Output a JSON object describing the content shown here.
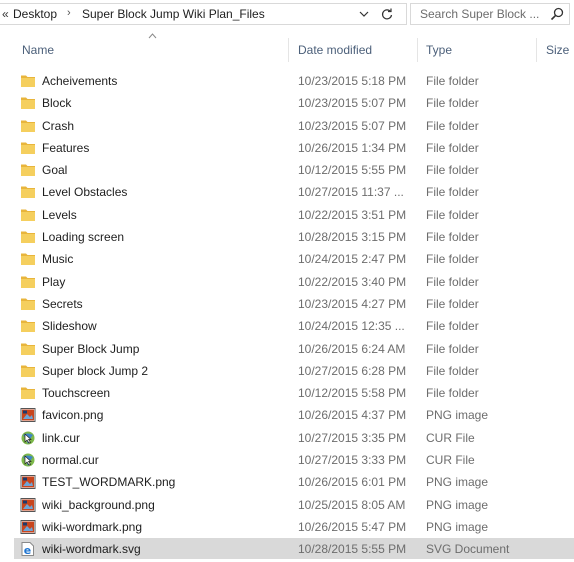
{
  "address_bar": {
    "overflow_glyph": "«",
    "crumbs": [
      "Desktop",
      "Super Block Jump Wiki Plan_Files"
    ],
    "separator": "›",
    "dropdown_icon": "chevron-down-icon",
    "refresh_icon": "refresh-icon"
  },
  "search": {
    "placeholder": "Search Super Block ...",
    "icon": "search-icon"
  },
  "columns": {
    "name": "Name",
    "date_modified": "Date modified",
    "type": "Type",
    "size": "Size",
    "sort_indicator": "sort-ascending-icon"
  },
  "colors": {
    "folder": "#f0c64a",
    "header_text": "#4c607a",
    "selected_row": "#d9d9d9"
  },
  "files": [
    {
      "name": "Acheivements",
      "date": "10/23/2015 5:18 PM",
      "type": "File folder",
      "icon": "folder-icon"
    },
    {
      "name": "Block",
      "date": "10/23/2015 5:07 PM",
      "type": "File folder",
      "icon": "folder-icon"
    },
    {
      "name": "Crash",
      "date": "10/23/2015 5:07 PM",
      "type": "File folder",
      "icon": "folder-icon"
    },
    {
      "name": "Features",
      "date": "10/26/2015 1:34 PM",
      "type": "File folder",
      "icon": "folder-icon"
    },
    {
      "name": "Goal",
      "date": "10/12/2015 5:55 PM",
      "type": "File folder",
      "icon": "folder-icon"
    },
    {
      "name": "Level Obstacles",
      "date": "10/27/2015 11:37 ...",
      "type": "File folder",
      "icon": "folder-icon"
    },
    {
      "name": "Levels",
      "date": "10/22/2015 3:51 PM",
      "type": "File folder",
      "icon": "folder-icon"
    },
    {
      "name": "Loading screen",
      "date": "10/28/2015 3:15 PM",
      "type": "File folder",
      "icon": "folder-icon"
    },
    {
      "name": "Music",
      "date": "10/24/2015 2:47 PM",
      "type": "File folder",
      "icon": "folder-icon"
    },
    {
      "name": "Play",
      "date": "10/22/2015 3:40 PM",
      "type": "File folder",
      "icon": "folder-icon"
    },
    {
      "name": "Secrets",
      "date": "10/23/2015 4:27 PM",
      "type": "File folder",
      "icon": "folder-icon"
    },
    {
      "name": "Slideshow",
      "date": "10/24/2015 12:35 ...",
      "type": "File folder",
      "icon": "folder-icon"
    },
    {
      "name": "Super Block Jump",
      "date": "10/26/2015 6:24 AM",
      "type": "File folder",
      "icon": "folder-icon"
    },
    {
      "name": "Super block Jump 2",
      "date": "10/27/2015 6:28 PM",
      "type": "File folder",
      "icon": "folder-icon"
    },
    {
      "name": "Touchscreen",
      "date": "10/12/2015 5:58 PM",
      "type": "File folder",
      "icon": "folder-icon"
    },
    {
      "name": "favicon.png",
      "date": "10/26/2015 4:37 PM",
      "type": "PNG image",
      "icon": "png-image-icon"
    },
    {
      "name": "link.cur",
      "date": "10/27/2015 3:35 PM",
      "type": "CUR File",
      "icon": "cursor-file-icon"
    },
    {
      "name": "normal.cur",
      "date": "10/27/2015 3:33 PM",
      "type": "CUR File",
      "icon": "cursor-file-icon"
    },
    {
      "name": "TEST_WORDMARK.png",
      "date": "10/26/2015 6:01 PM",
      "type": "PNG image",
      "icon": "png-image-icon"
    },
    {
      "name": "wiki_background.png",
      "date": "10/25/2015 8:05 AM",
      "type": "PNG image",
      "icon": "png-image-icon"
    },
    {
      "name": "wiki-wordmark.png",
      "date": "10/26/2015 5:47 PM",
      "type": "PNG image",
      "icon": "png-image-icon"
    },
    {
      "name": "wiki-wordmark.svg",
      "date": "10/28/2015 5:55 PM",
      "type": "SVG Document",
      "icon": "svg-document-icon",
      "selected": true
    }
  ]
}
